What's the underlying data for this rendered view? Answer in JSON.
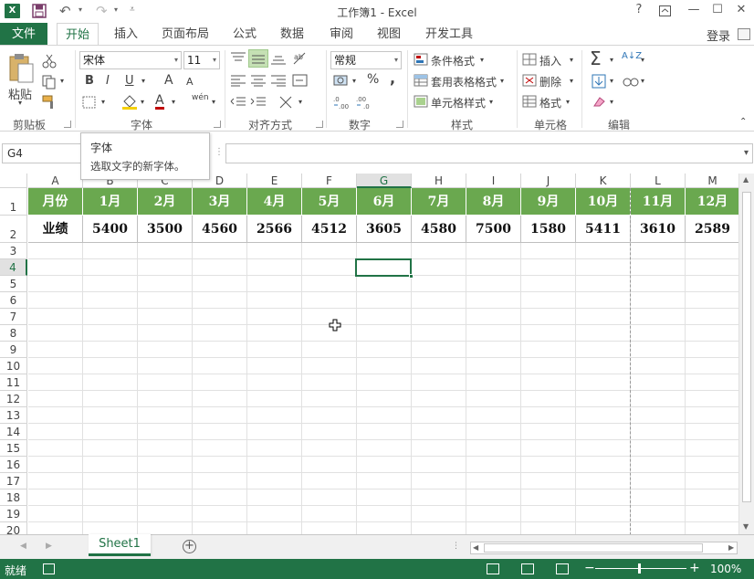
{
  "window": {
    "title": "工作簿1 - Excel",
    "help": "?",
    "restore_icon": "ribbon-display-icon",
    "minimize": "—",
    "maximize": "☐",
    "close": "✕"
  },
  "qat": {
    "undo": "↶",
    "redo": "↷",
    "dropdown": "▾",
    "customize": "⩡"
  },
  "tabs": {
    "file": "文件",
    "items": [
      "开始",
      "插入",
      "页面布局",
      "公式",
      "数据",
      "审阅",
      "视图",
      "开发工具"
    ],
    "active": "开始",
    "login": "登录"
  },
  "ribbon": {
    "clipboard": {
      "label": "剪贴板",
      "paste": "粘贴"
    },
    "font": {
      "label": "字体",
      "font_name": "宋体",
      "font_size": "11",
      "bold": "B",
      "italic": "I",
      "underline": "U",
      "grow": "A",
      "shrink": "A",
      "font_color": "A",
      "phonetic": "wén"
    },
    "alignment": {
      "label": "对齐方式"
    },
    "number": {
      "label": "数字",
      "format": "常规",
      "percent": "%",
      "comma": ",",
      "inc_dec": ".00 →.0",
      "dec_dec": ".00 ←.0"
    },
    "styles": {
      "label": "样式",
      "conditional": "条件格式",
      "table": "套用表格格式",
      "cell_styles": "单元格样式"
    },
    "cells": {
      "label": "单元格",
      "insert": "插入",
      "delete": "删除",
      "format": "格式"
    },
    "editing": {
      "label": "编辑",
      "sum": "Σ",
      "sort": "A↓Z"
    }
  },
  "tooltip": {
    "title": "字体",
    "desc": "选取文字的新字体。"
  },
  "formula_bar": {
    "name_box": "G4",
    "value": ""
  },
  "sheet": {
    "columns": [
      "A",
      "B",
      "C",
      "D",
      "E",
      "F",
      "G",
      "H",
      "I",
      "J",
      "K",
      "L",
      "M"
    ],
    "selected_col": "G",
    "rows": [
      "1",
      "2",
      "3",
      "4",
      "5",
      "6",
      "7",
      "8",
      "9",
      "10",
      "11",
      "12",
      "13",
      "14",
      "15",
      "16",
      "17",
      "18",
      "19",
      "20"
    ],
    "selected_row": "4",
    "row1": [
      "月份",
      "1月",
      "2月",
      "3月",
      "4月",
      "5月",
      "6月",
      "7月",
      "8月",
      "9月",
      "10月",
      "11月",
      "12月"
    ],
    "row2": [
      "业绩",
      "5400",
      "3500",
      "4560",
      "2566",
      "4512",
      "3605",
      "4580",
      "7500",
      "1580",
      "5411",
      "3610",
      "2589"
    ],
    "header_fill": "#6aa84f",
    "accent": "#217346"
  },
  "sheet_tabs": {
    "active": "Sheet1",
    "add": "+"
  },
  "status": {
    "ready": "就绪",
    "zoom": "100%",
    "zoom_minus": "−",
    "zoom_plus": "+"
  }
}
